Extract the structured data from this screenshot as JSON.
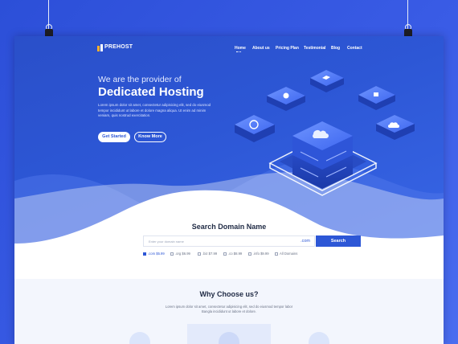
{
  "brand": {
    "logo_text": "PREHOST"
  },
  "nav": {
    "items": [
      "Home",
      "About us",
      "Pricing Plan",
      "Testimonial",
      "Blog",
      "Contact"
    ],
    "active": "Home"
  },
  "hero": {
    "tagline": "We are the provider of",
    "title": "Dedicated Hosting",
    "text": "Lorem ipsum dolor sit amet, consectetur adipisicing elit, sed do eiusmod tempor incididunt ut labore et dolore magna aliqua. Ut enim ad minim veniam, quis nostrud exercitation.",
    "primary_button": "Get Started",
    "secondary_button": "Know More"
  },
  "domain_search": {
    "title": "Search Domain Name",
    "placeholder": "Enter your domain name",
    "suffix": ".com",
    "button": "Search",
    "options": [
      {
        "label": ".com $5.99",
        "checked": true
      },
      {
        "label": ".org $6.99",
        "checked": false
      },
      {
        "label": ".biz $7.99",
        "checked": false
      },
      {
        "label": ".co $8.99",
        "checked": false
      },
      {
        "label": ".info $9.99",
        "checked": false
      },
      {
        "label": "All Domains",
        "checked": false
      }
    ]
  },
  "why": {
    "title": "Why Choose us?",
    "text": "Lorem ipsum dolor sit amet, consectetur adipisicing elit, sed do eiusmod tempor labor Bangla incididunt ut labore et dolore."
  },
  "colors": {
    "primary": "#2d57d6",
    "hero_dark": "#2a4fc9",
    "light_bg": "#f3f6fd"
  }
}
